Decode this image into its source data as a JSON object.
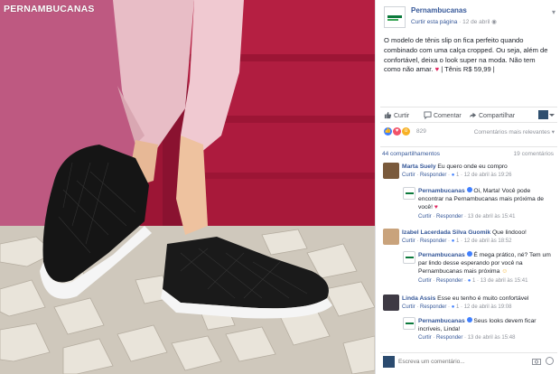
{
  "photo": {
    "brand_watermark": "PERNAMBUCANAS"
  },
  "post": {
    "page_name": "Pernambucanas",
    "like_page": "Curtir esta página",
    "date": "12 de abril",
    "text_main": "O modelo de tênis slip on fica perfeito quando combinado com uma calça cropped. Ou seja, além de confortável, deixa o look super na moda. Não tem como não amar.",
    "text_tail": "| Tênis R$ 59,99 |"
  },
  "actions": {
    "like": "Curtir",
    "comment": "Comentar",
    "share": "Compartilhar"
  },
  "reactions": {
    "count": "829",
    "sort_label": "Comentários mais relevantes"
  },
  "shares": {
    "shares_label": "44 compartilhamentos",
    "comments_label": "19 comentários"
  },
  "labels": {
    "like": "Curtir",
    "reply": "Responder",
    "separator": "·"
  },
  "comments": [
    {
      "name": "Marta Suely",
      "text": "Eu quero onde eu compro",
      "likes": "1",
      "time": "12 de abril às 19:26"
    },
    {
      "name": "Pernambucanas",
      "text": "Oi, Marta! Você pode encontrar na Pernambucanas mais próxima de você!",
      "time": "13 de abril às 15:41"
    },
    {
      "name": "Izabel Lacerdada Silva Guomik",
      "text": "Que lindooo!",
      "likes": "1",
      "time": "12 de abril às 18:52"
    },
    {
      "name": "Pernambucanas",
      "text": "É mega prático, né? Tem um par lindo desse esperando por você na Pernambucanas mais próxima",
      "likes": "1",
      "time": "13 de abril às 15:41"
    },
    {
      "name": "Linda Assis",
      "text": "Esse eu tenho é muito confortável",
      "likes": "1",
      "time": "12 de abril às 19:08"
    },
    {
      "name": "Pernambucanas",
      "text": "Seus looks devem ficar incríveis, Linda!",
      "time": "13 de abril às 15:48"
    }
  ],
  "composer": {
    "placeholder": "Escreva um comentário..."
  },
  "colors": {
    "link": "#365899",
    "meta": "#90949c",
    "text": "#1d2129",
    "bench": "#a8193a",
    "brand_green": "#0c7a3c"
  }
}
